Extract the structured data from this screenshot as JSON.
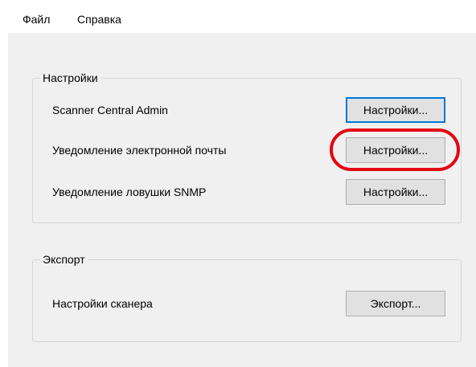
{
  "menu": {
    "file": "Файл",
    "help": "Справка"
  },
  "settings_group": {
    "title": "Настройки",
    "rows": [
      {
        "label": "Scanner Central Admin",
        "button": "Настройки..."
      },
      {
        "label": "Уведомление электронной почты",
        "button": "Настройки..."
      },
      {
        "label": "Уведомление ловушки SNMP",
        "button": "Настройки..."
      }
    ]
  },
  "export_group": {
    "title": "Экспорт",
    "rows": [
      {
        "label": "Настройки сканера",
        "button": "Экспорт..."
      }
    ]
  },
  "highlight": {
    "target": "Уведомление электронной почты",
    "color": "#e30613"
  },
  "colors": {
    "window_bg": "#f0f0f0",
    "button_bg": "#e1e1e1",
    "focus_border": "#0078d7"
  }
}
